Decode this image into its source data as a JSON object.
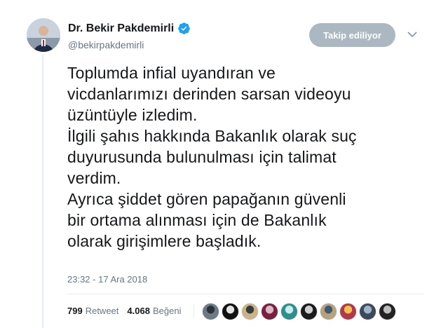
{
  "author": {
    "display_name": "Dr. Bekir Pakdemirli",
    "handle": "@bekirpakdemirli",
    "verified_icon": "verified-badge-icon"
  },
  "follow_button": {
    "label": "Takip ediliyor"
  },
  "caret_icon": "chevron-down-icon",
  "tweet": {
    "lines": [
      "Toplumda infial uyandıran ve",
      "vicdanlarımızı derinden sarsan videoyu",
      "üzüntüyle izledim.",
      "İlgili şahıs hakkında Bakanlık olarak suç",
      "duyurusunda bulunulması için talimat",
      "verdim.",
      "Ayrıca şiddet gören papağanın güvenli",
      "bir ortama alınması için de Bakanlık",
      "olarak girişimlere başladık."
    ],
    "timestamp": "23:32 - 17 Ara 2018"
  },
  "stats": {
    "retweets": {
      "count": "799",
      "label": "Retweet"
    },
    "likes": {
      "count": "4.068",
      "label": "Beğeni"
    }
  },
  "colors": {
    "verified": "#1da1f2",
    "follow_bg": "#abb8c2",
    "secondary_text": "#657786"
  },
  "likers": [
    {
      "avatar_colors": [
        "#6d7a86",
        "#2c3338"
      ]
    },
    {
      "avatar_colors": [
        "#111111",
        "#e2e2e2"
      ]
    },
    {
      "avatar_colors": [
        "#c9b48a",
        "#3a3a3a"
      ]
    },
    {
      "avatar_colors": [
        "#7a1f3d",
        "#d9b9c6"
      ]
    },
    {
      "avatar_colors": [
        "#2f8f8a",
        "#c7efe9"
      ]
    },
    {
      "avatar_colors": [
        "#1b1b1b",
        "#cfcfcf"
      ]
    },
    {
      "avatar_colors": [
        "#b8a27c",
        "#3d5a74"
      ]
    },
    {
      "avatar_colors": [
        "#b23a48",
        "#f2c14e"
      ]
    },
    {
      "avatar_colors": [
        "#3b4a5a",
        "#9fb4c7"
      ]
    },
    {
      "avatar_colors": [
        "#222222",
        "#bdbdbd"
      ]
    }
  ]
}
